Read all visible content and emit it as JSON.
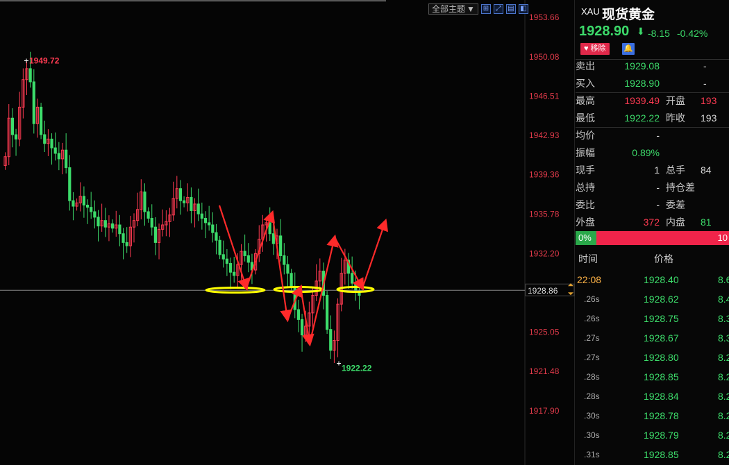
{
  "chart": {
    "theme_select": "全部主题",
    "toolbar_icons": [
      "grid-icon",
      "expand-icon",
      "layout-icon",
      "split-icon"
    ],
    "y_axis_labels": [
      "1953.66",
      "1950.08",
      "1946.51",
      "1942.93",
      "1939.36",
      "1935.78",
      "1932.20",
      "1928.86",
      "1925.05",
      "1921.48",
      "1917.90"
    ],
    "current_price_label": "1928.86",
    "high_marker": "1949.72",
    "low_marker": "1922.22",
    "colors": {
      "up": "#ff3b52",
      "down": "#3ddc6b",
      "annotation": "#ff2a2a",
      "highlight": "#ffff00",
      "price_line": "#888888"
    }
  },
  "chart_data": {
    "type": "candlestick",
    "ylim": [
      1916.5,
      1955.0
    ],
    "y_ticks": [
      1953.66,
      1950.08,
      1946.51,
      1942.93,
      1939.36,
      1935.78,
      1932.2,
      1925.05,
      1921.48,
      1917.9
    ],
    "current_price": 1928.86,
    "high": 1949.72,
    "low": 1922.22,
    "closes": [
      1941.0,
      1944.5,
      1943.0,
      1942.6,
      1945.5,
      1948.0,
      1949.0,
      1947.8,
      1944.0,
      1945.5,
      1943.0,
      1942.2,
      1942.6,
      1941.8,
      1941.3,
      1940.8,
      1941.6,
      1940.0,
      1937.0,
      1936.5,
      1936.8,
      1937.4,
      1936.6,
      1936.4,
      1936.0,
      1935.5,
      1934.7,
      1935.2,
      1934.6,
      1934.9,
      1934.5,
      1934.8,
      1934.0,
      1933.2,
      1932.9,
      1934.6,
      1935.2,
      1936.2,
      1937.8,
      1936.0,
      1935.4,
      1934.6,
      1933.2,
      1934.4,
      1934.8,
      1935.1,
      1935.7,
      1937.2,
      1938.1,
      1937.0,
      1936.8,
      1937.3,
      1936.1,
      1936.7,
      1935.8,
      1935.4,
      1935.0,
      1934.8,
      1934.1,
      1933.4,
      1932.1,
      1931.7,
      1931.3,
      1930.5,
      1930.2,
      1931.2,
      1932.4,
      1932.0,
      1931.4,
      1930.7,
      1932.2,
      1933.5,
      1934.8,
      1935.0,
      1934.0,
      1933.1,
      1933.8,
      1932.0,
      1931.2,
      1930.4,
      1929.2,
      1927.1,
      1926.2,
      1924.8,
      1925.6,
      1926.8,
      1928.4,
      1929.7,
      1930.6,
      1928.4,
      1925.3,
      1923.4,
      1924.3,
      1927.6,
      1930.4,
      1931.6,
      1930.4,
      1929.5,
      1928.8,
      1928.4
    ],
    "annotations": {
      "arrows": [
        [
          [
            316,
            296
          ],
          [
            355,
            415
          ]
        ],
        [
          [
            355,
            415
          ],
          [
            392,
            307
          ]
        ],
        [
          [
            392,
            307
          ],
          [
            414,
            460
          ]
        ],
        [
          [
            414,
            460
          ],
          [
            433,
            414
          ]
        ],
        [
          [
            433,
            414
          ],
          [
            446,
            495
          ]
        ],
        [
          [
            446,
            495
          ],
          [
            482,
            342
          ]
        ],
        [
          [
            482,
            342
          ],
          [
            522,
            415
          ]
        ],
        [
          [
            522,
            415
          ],
          [
            555,
            319
          ]
        ]
      ],
      "ellipses": [
        [
          339,
          418,
          42
        ],
        [
          430,
          417,
          35
        ],
        [
          512,
          417,
          26
        ]
      ]
    }
  },
  "quote": {
    "code": "XAU",
    "name": "现货黄金",
    "price": "1928.90",
    "change": "-8.15",
    "change_pct": "-0.42%",
    "remove_label": "移除",
    "rows": [
      {
        "label": "卖出",
        "value": "1929.08",
        "label2": "",
        "value2": "-"
      },
      {
        "label": "买入",
        "value": "1928.90",
        "label2": "",
        "value2": "-"
      },
      {
        "label": "最高",
        "value": "1939.49",
        "label2": "开盘",
        "value2": "193"
      },
      {
        "label": "最低",
        "value": "1922.22",
        "label2": "昨收",
        "value2": "193"
      },
      {
        "label": "均价",
        "value": "-",
        "label2": "",
        "value2": ""
      },
      {
        "label": "振幅",
        "value": "0.89%",
        "label2": "",
        "value2": ""
      },
      {
        "label": "现手",
        "value": "1",
        "label2": "总手",
        "value2": "84"
      },
      {
        "label": "总持",
        "value": "-",
        "label2": "持仓差",
        "value2": ""
      },
      {
        "label": "委比",
        "value": "-",
        "label2": "委差",
        "value2": ""
      },
      {
        "label": "外盘",
        "value": "372",
        "label2": "内盘",
        "value2": "81"
      }
    ],
    "ratio_left": "0%",
    "ratio_right": "10",
    "ticks_header": {
      "time": "时间",
      "price": "价格"
    },
    "ticks": [
      {
        "time": "22:08",
        "price": "1928.40",
        "vol": "8.6"
      },
      {
        "time": ".26s",
        "price": "1928.62",
        "vol": "8.4"
      },
      {
        "time": ".26s",
        "price": "1928.75",
        "vol": "8.3"
      },
      {
        "time": ".27s",
        "price": "1928.67",
        "vol": "8.3"
      },
      {
        "time": ".27s",
        "price": "1928.80",
        "vol": "8.2"
      },
      {
        "time": ".28s",
        "price": "1928.85",
        "vol": "8.2"
      },
      {
        "time": ".28s",
        "price": "1928.84",
        "vol": "8.2"
      },
      {
        "time": ".30s",
        "price": "1928.78",
        "vol": "8.2"
      },
      {
        "time": ".30s",
        "price": "1928.79",
        "vol": "8.2"
      },
      {
        "time": ".31s",
        "price": "1928.85",
        "vol": "8.2"
      }
    ]
  }
}
